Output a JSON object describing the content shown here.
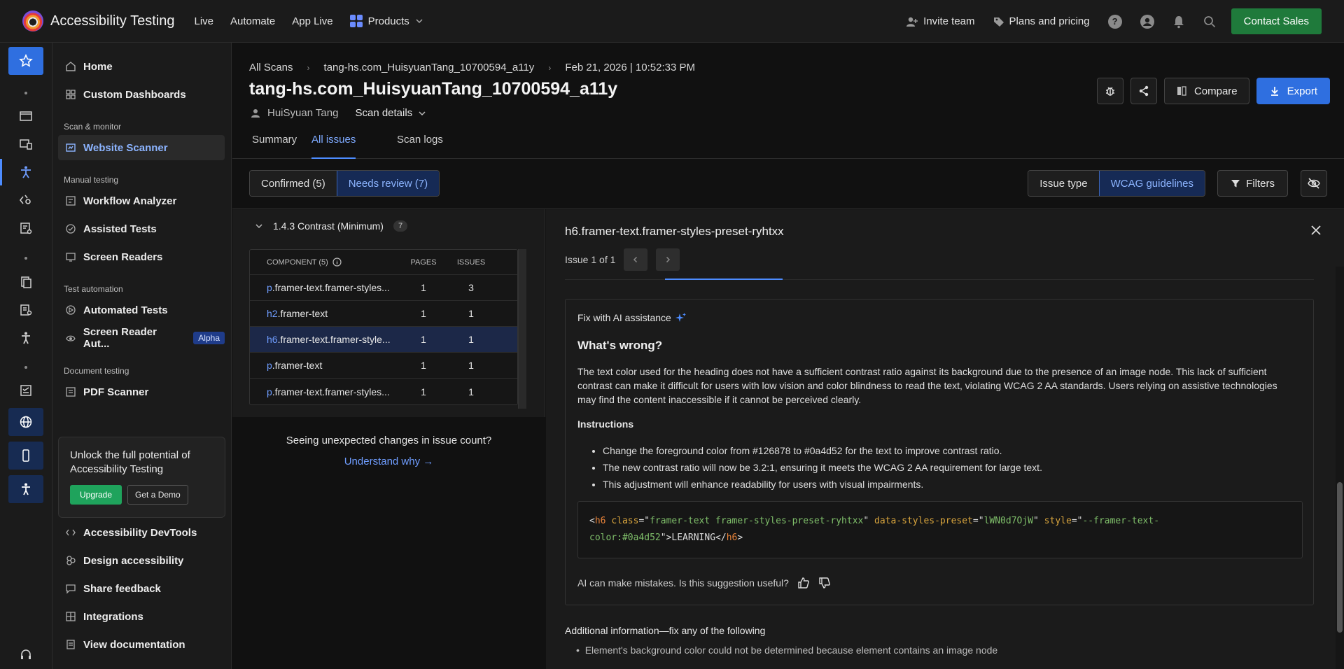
{
  "topbar": {
    "app_title": "Accessibility Testing",
    "nav": [
      "Live",
      "Automate",
      "App Live"
    ],
    "products_label": "Products",
    "invite_team": "Invite team",
    "plans_pricing": "Plans and pricing",
    "contact_sales": "Contact Sales"
  },
  "sidebar": {
    "home": "Home",
    "custom_dashboards": "Custom Dashboards",
    "section_scan": "Scan & monitor",
    "website_scanner": "Website Scanner",
    "section_manual": "Manual testing",
    "workflow_analyzer": "Workflow Analyzer",
    "assisted_tests": "Assisted Tests",
    "screen_readers": "Screen Readers",
    "section_automation": "Test automation",
    "automated_tests": "Automated Tests",
    "screen_reader_auto": "Screen Reader Aut...",
    "alpha": "Alpha",
    "section_document": "Document testing",
    "pdf_scanner": "PDF Scanner",
    "promo_text": "Unlock the full potential of Accessibility Testing",
    "upgrade": "Upgrade",
    "get_demo": "Get a Demo",
    "devtools": "Accessibility DevTools",
    "design": "Design accessibility",
    "share_feedback": "Share feedback",
    "integrations": "Integrations",
    "view_docs": "View documentation"
  },
  "header": {
    "crumb_all_scans": "All Scans",
    "crumb_scan": "tang-hs.com_HuisyuanTang_10700594_a11y",
    "crumb_date": "Feb 21, 2026 | 10:52:33 PM",
    "title": "tang-hs.com_HuisyuanTang_10700594_a11y",
    "user": "HuiSyuan Tang",
    "scan_details": "Scan details",
    "compare": "Compare",
    "export": "Export"
  },
  "tabs": {
    "summary": "Summary",
    "all_issues": "All issues",
    "scan_logs": "Scan logs"
  },
  "filterbar": {
    "confirmed": "Confirmed (5)",
    "needs_review": "Needs review (7)",
    "issue_type": "Issue type",
    "wcag": "WCAG guidelines",
    "filters": "Filters"
  },
  "list": {
    "criterion": "1.4.3 Contrast (Minimum)",
    "criterion_count": "7",
    "head_component": "COMPONENT (5)",
    "head_pages": "PAGES",
    "head_issues": "ISSUES",
    "rows": [
      {
        "tag": "p",
        "rest": ".framer-text.framer-styles...",
        "pages": "1",
        "issues": "3"
      },
      {
        "tag": "h2",
        "rest": ".framer-text",
        "pages": "1",
        "issues": "1"
      },
      {
        "tag": "h6",
        "rest": ".framer-text.framer-style...",
        "pages": "1",
        "issues": "1"
      },
      {
        "tag": "p",
        "rest": ".framer-text",
        "pages": "1",
        "issues": "1"
      },
      {
        "tag": "p",
        "rest": ".framer-text.framer-styles...",
        "pages": "1",
        "issues": "1"
      }
    ],
    "unexpected": "Seeing unexpected changes in issue count?",
    "understand_why": "Understand why →"
  },
  "detail": {
    "title": "h6.framer-text.framer-styles-preset-ryhtxx",
    "issue_nav": "Issue 1 of 1",
    "ai_heading": "Fix with AI assistance",
    "wrong_heading": "What's wrong?",
    "wrong_text": "The text color used for the heading does not have a sufficient contrast ratio against its background due to the presence of an image node. This lack of sufficient contrast can make it difficult for users with low vision and color blindness to read the text, violating WCAG 2 AA standards. Users relying on assistive technologies may find the content inaccessible if it cannot be perceived clearly.",
    "instructions_heading": "Instructions",
    "instructions": [
      "Change the foreground color from #126878 to #0a4d52 for the text to improve contrast ratio.",
      "The new contrast ratio will now be 3.2:1, ensuring it meets the WCAG 2 AA requirement for large text.",
      "This adjustment will enhance readability for users with visual impairments."
    ],
    "code": {
      "tag": "h6",
      "class_attr": "class",
      "class_val": "framer-text framer-styles-preset-ryhtxx",
      "preset_attr": "data-styles-preset",
      "preset_val": "lWN0d7OjW",
      "style_attr": "style",
      "style_val_1": "--framer-text-",
      "style_val_2": "color:#0a4d52",
      "content": "LEARNING"
    },
    "feedback": "AI can make mistakes. Is this suggestion useful?",
    "additional_heading": "Additional information—fix any of the following",
    "additional_item": "Element's background color could not be determined because element contains an image node"
  },
  "colors": {
    "accent": "#4d8cff",
    "contact_green": "#1f7a3b",
    "upgrade_green": "#1fa35c"
  }
}
